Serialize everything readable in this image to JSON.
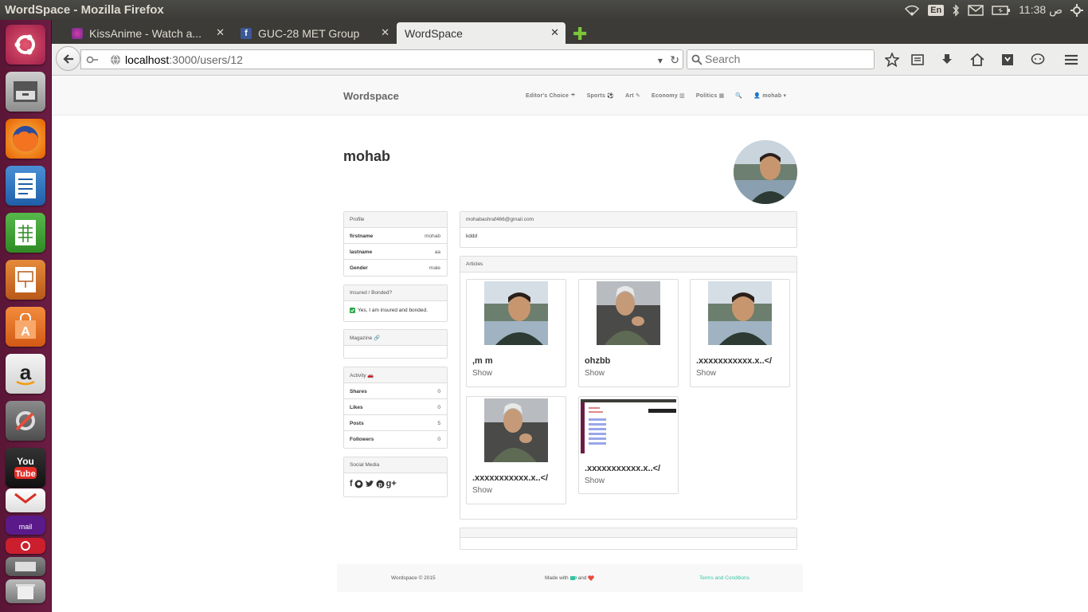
{
  "os": {
    "window_title": "WordSpace - Mozilla Firefox",
    "keyboard_layout": "En",
    "clock": "11:38 ص"
  },
  "browser": {
    "tabs": [
      {
        "label": "KissAnime - Watch a..."
      },
      {
        "label": "GUC-28 MET Group"
      },
      {
        "label": "WordSpace"
      }
    ],
    "url_host": "localhost",
    "url_path": ":3000/users/12",
    "search_placeholder": "Search"
  },
  "site": {
    "brand": "Wordspace",
    "nav": {
      "editors_choice": "Editor's Choice ☂",
      "sports": "Sports ⚽",
      "art": "Art ✎",
      "economy": "Economy ▥",
      "politics": "Politics ▦",
      "search": "🔍",
      "user": "👤 mohab ▾"
    }
  },
  "profile": {
    "username": "mohab",
    "profile_header": "Profile",
    "fields": [
      {
        "key": "firstname",
        "value": "mohab"
      },
      {
        "key": "lastname",
        "value": "aa"
      },
      {
        "key": "Gender",
        "value": "male"
      }
    ],
    "insured_header": "Insured / Bonded?",
    "insured_text": "Yes, I am insured and bonded.",
    "magazine_header": "Magazine 🔗",
    "activity_header": "Activity 🚗",
    "activity": [
      {
        "key": "Shares",
        "value": "0"
      },
      {
        "key": "Likes",
        "value": "0"
      },
      {
        "key": "Posts",
        "value": "5"
      },
      {
        "key": "Followers",
        "value": "0"
      }
    ],
    "social_header": "Social Media",
    "email": "mohabashraf466@gmail.com",
    "bio": "kddd"
  },
  "articles": {
    "header": "Articles",
    "items": [
      {
        "title": ",m m",
        "action": "Show"
      },
      {
        "title": "ohzbb",
        "action": "Show"
      },
      {
        "title": ".xxxxxxxxxxx.x..</",
        "action": "Show"
      },
      {
        "title": ".xxxxxxxxxxx.x..</",
        "action": "Show"
      },
      {
        "title": ".xxxxxxxxxxx.x..</",
        "action": "Show"
      }
    ]
  },
  "footer": {
    "copyright": "Wordspace © 2015",
    "made_with": "Made with",
    "and": "and",
    "terms": "Terms and Conditions"
  }
}
